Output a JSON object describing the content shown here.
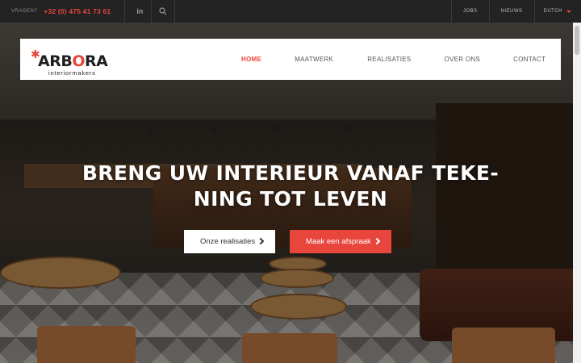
{
  "topbar": {
    "question_label": "VRAGEN?",
    "phone": "+32 (0) 475 41 73 61",
    "linkedin_icon": "linkedin-icon",
    "search_icon": "search-icon",
    "links": [
      "JOBS",
      "NIEUWS"
    ],
    "language": "DUTCH"
  },
  "logo": {
    "word_start": "ARB",
    "word_accent": "O",
    "word_end": "RA",
    "subtitle": "interiormakers"
  },
  "nav": {
    "items": [
      "HOME",
      "MAATWERK",
      "REALISATIES",
      "OVER ONS",
      "CONTACT"
    ],
    "active": "HOME"
  },
  "hero": {
    "headline_line1": "BRENG UW INTERIEUR VANAF TEKE-",
    "headline_line2": "NING TOT LEVEN",
    "button_primary": "Onze realisaties",
    "button_secondary": "Maak een afspraak"
  },
  "colors": {
    "accent": "#e8453c",
    "topbar_bg": "#232323",
    "nav_bg": "#ffffff"
  }
}
